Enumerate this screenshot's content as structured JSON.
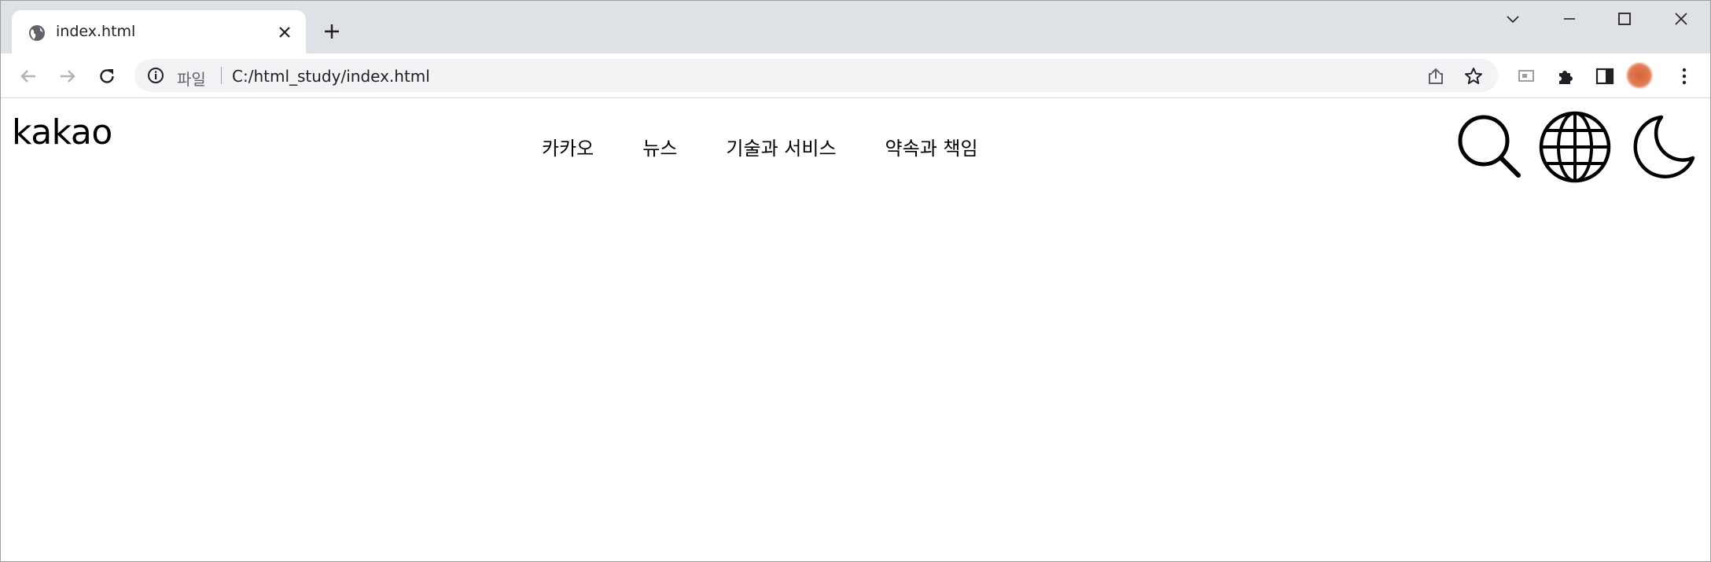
{
  "browser": {
    "tab": {
      "title": "index.html",
      "favicon": "globe-icon"
    },
    "address_bar": {
      "scheme_label": "파일",
      "url": "C:/html_study/index.html"
    },
    "colors": {
      "tabstrip": "#dee1e6",
      "omnibox": "#f1f3f4",
      "icon": "#5f6368"
    }
  },
  "page": {
    "logo": "kakao",
    "nav": [
      {
        "label": "카카오"
      },
      {
        "label": "뉴스"
      },
      {
        "label": "기술과 서비스"
      },
      {
        "label": "약속과 책임"
      }
    ],
    "header_icons": [
      "search-icon",
      "globe-icon",
      "moon-icon"
    ]
  }
}
